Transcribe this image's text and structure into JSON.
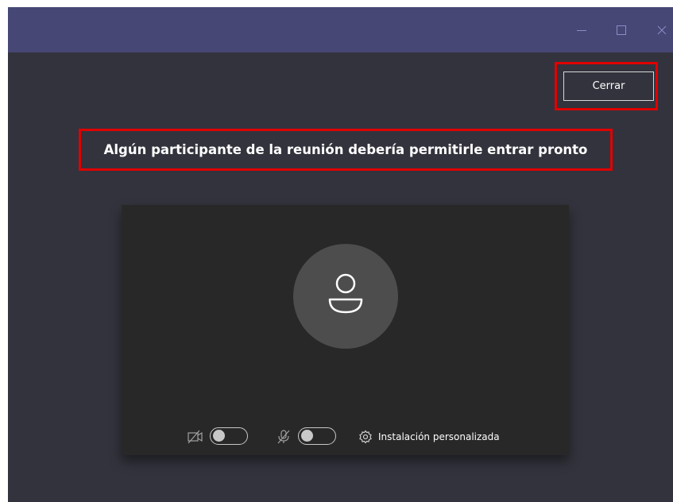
{
  "window": {
    "controls": {
      "minimize": "minimize-icon",
      "maximize": "maximize-icon",
      "close": "close-icon"
    }
  },
  "header": {
    "close_button_label": "Cerrar"
  },
  "message": {
    "text": "Algún participante de la reunión debería permitirle entrar pronto"
  },
  "preview": {
    "avatar_icon": "person-icon",
    "camera": {
      "icon": "camera-off-icon",
      "enabled": false
    },
    "microphone": {
      "icon": "mic-off-icon",
      "enabled": false
    },
    "settings": {
      "icon": "gear-icon",
      "label": "Instalación personalizada"
    }
  },
  "colors": {
    "titlebar": "#464775",
    "background": "#33333d",
    "preview_bg": "#282828",
    "highlight": "#e00000"
  }
}
